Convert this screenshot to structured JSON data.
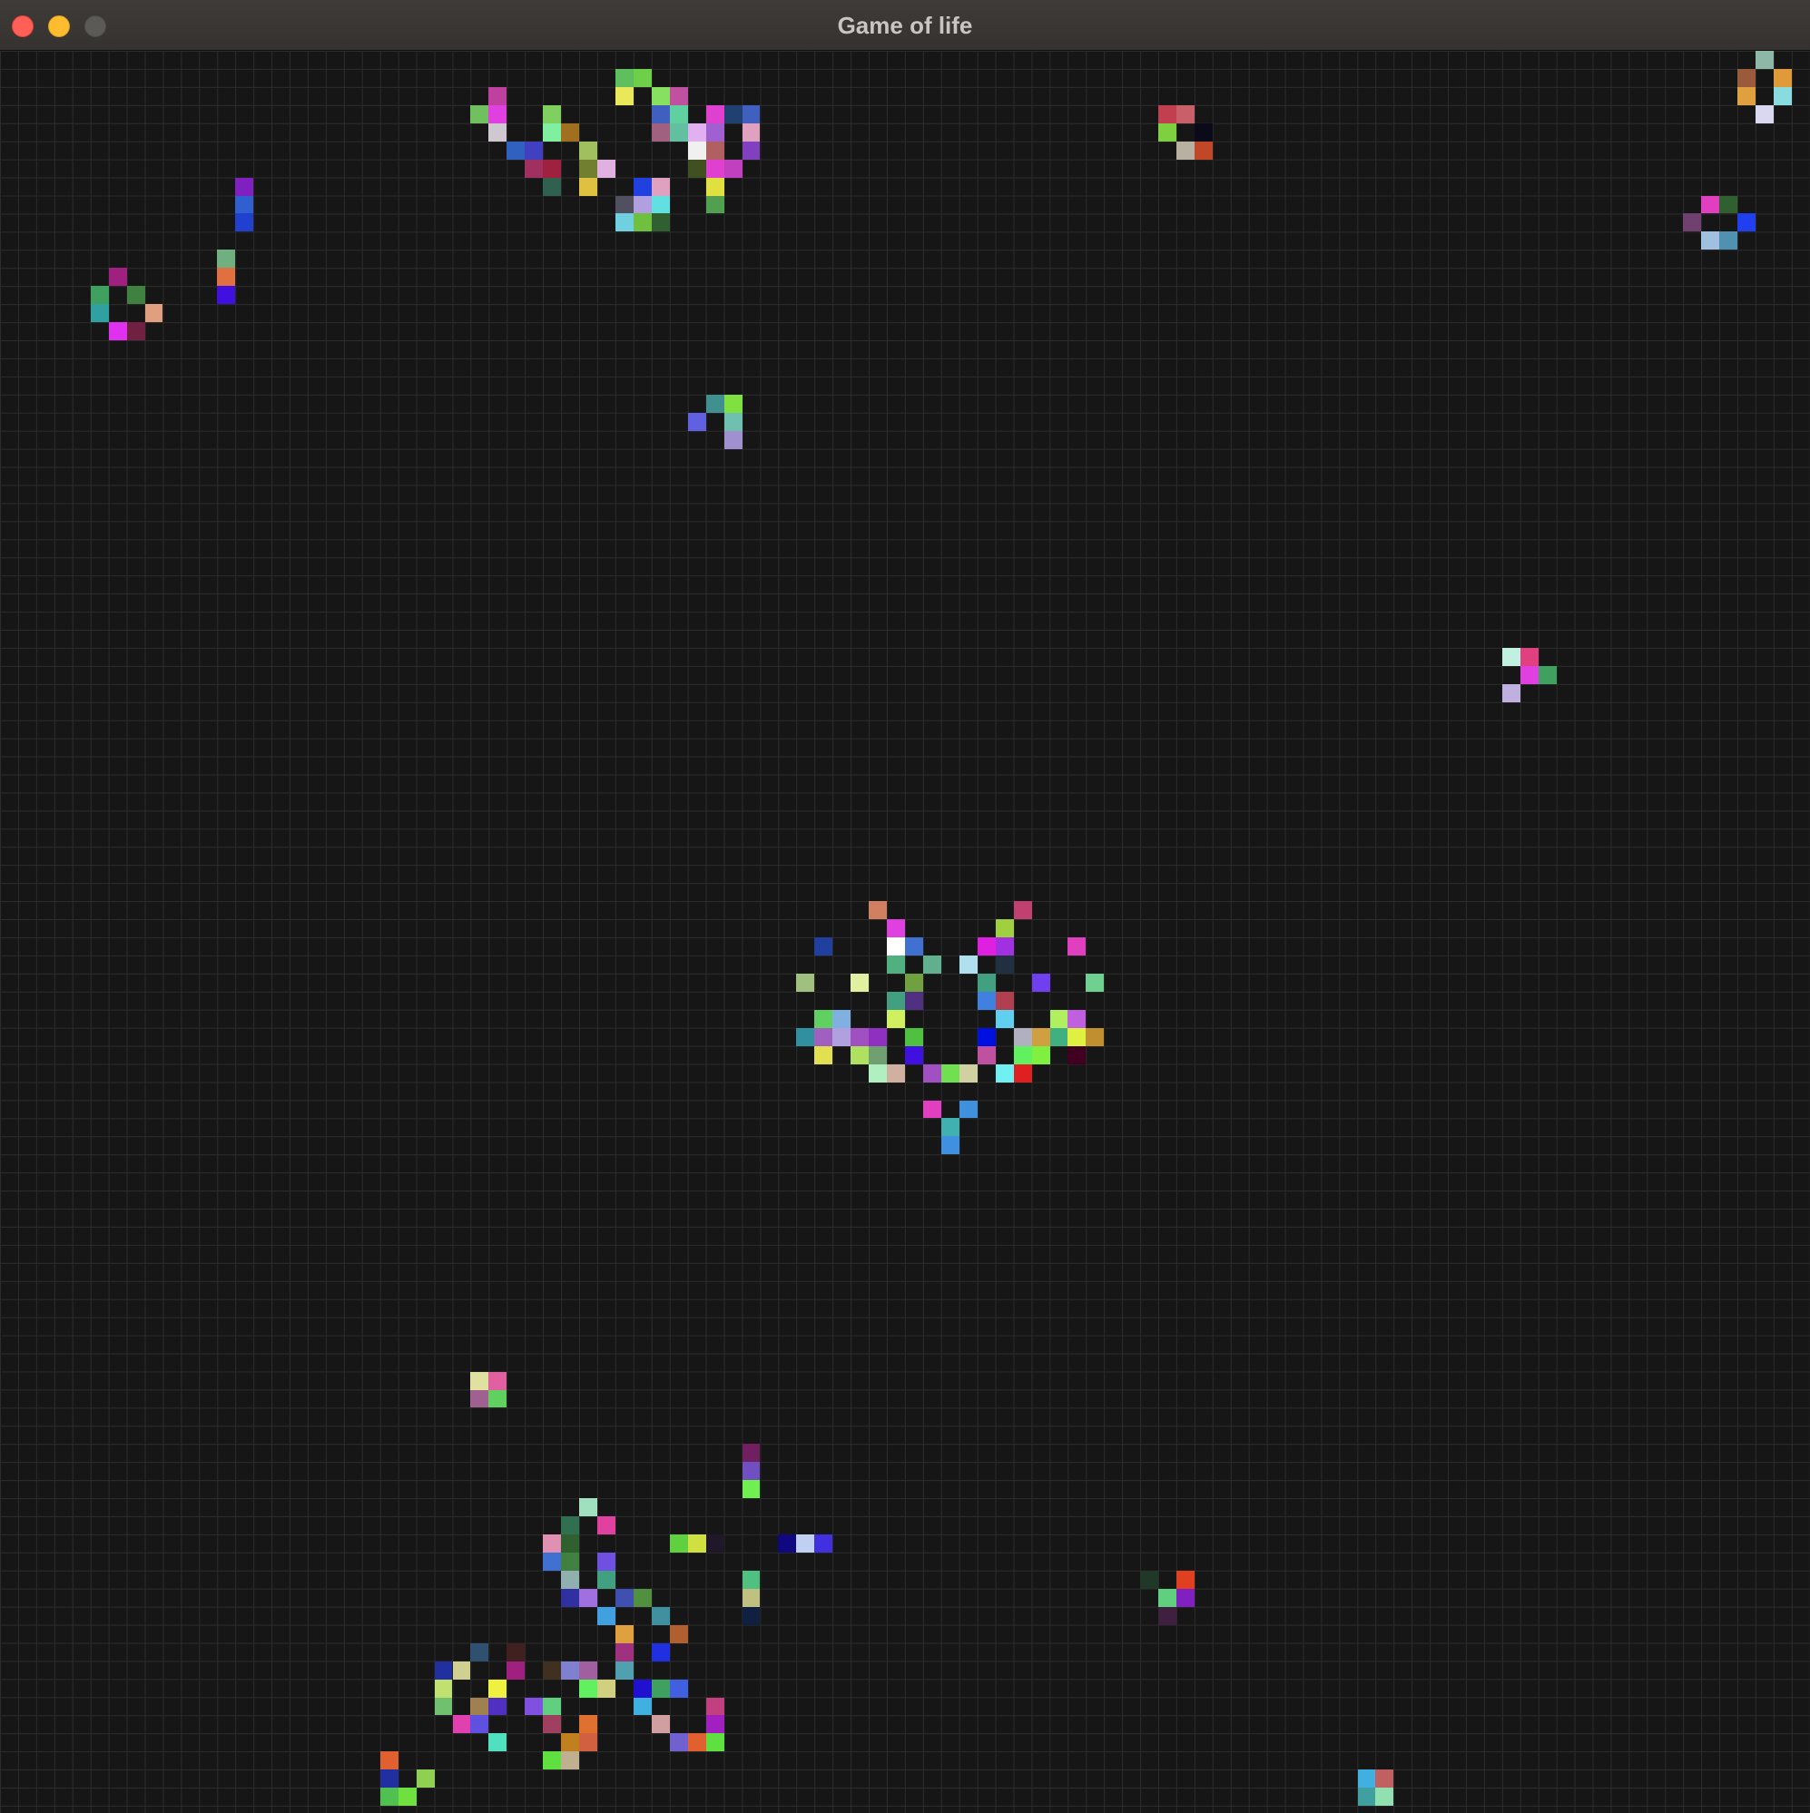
{
  "window": {
    "title": "Game of life"
  },
  "traffic_lights": {
    "close_color": "#ff5f57",
    "minimize_color": "#febc2e",
    "maximize_color": "#5c5a57"
  },
  "board": {
    "columns": 100,
    "rows": 97,
    "background_color": "#161616",
    "grid_line_color": "#2c2c2c",
    "live_cells": [
      [
        97,
        0,
        "#8fb7a8"
      ],
      [
        96,
        1,
        "#9a5a3c"
      ],
      [
        98,
        1,
        "#e09a3a"
      ],
      [
        96,
        2,
        "#e0a040"
      ],
      [
        98,
        2,
        "#8adbe0"
      ],
      [
        97,
        3,
        "#d8d8f0"
      ],
      [
        64,
        3,
        "#c04050"
      ],
      [
        65,
        3,
        "#c8606a"
      ],
      [
        64,
        4,
        "#7ed040"
      ],
      [
        66,
        4,
        "#0a0a18"
      ],
      [
        65,
        5,
        "#b8b0a0"
      ],
      [
        66,
        5,
        "#c04828"
      ],
      [
        34,
        1,
        "#5fbf5f"
      ],
      [
        35,
        1,
        "#6ed04a"
      ],
      [
        34,
        2,
        "#e8e85a"
      ],
      [
        36,
        2,
        "#88e060"
      ],
      [
        37,
        2,
        "#c050a0"
      ],
      [
        27,
        2,
        "#c040a0"
      ],
      [
        26,
        3,
        "#70c060"
      ],
      [
        27,
        3,
        "#e040e0"
      ],
      [
        30,
        3,
        "#80d060"
      ],
      [
        36,
        3,
        "#4060c0"
      ],
      [
        37,
        3,
        "#60d0a0"
      ],
      [
        39,
        3,
        "#e040d0"
      ],
      [
        40,
        3,
        "#204070"
      ],
      [
        41,
        3,
        "#4060c0"
      ],
      [
        27,
        4,
        "#d0c8d0"
      ],
      [
        30,
        4,
        "#80f0a0"
      ],
      [
        31,
        4,
        "#a07020"
      ],
      [
        36,
        4,
        "#a06080"
      ],
      [
        37,
        4,
        "#60c0a0"
      ],
      [
        38,
        4,
        "#e0b0f0"
      ],
      [
        39,
        4,
        "#a060d0"
      ],
      [
        41,
        4,
        "#e0a0c0"
      ],
      [
        28,
        5,
        "#3060c0"
      ],
      [
        29,
        5,
        "#4040c0"
      ],
      [
        32,
        5,
        "#a0c060"
      ],
      [
        38,
        5,
        "#f0f0f0"
      ],
      [
        39,
        5,
        "#b06060"
      ],
      [
        41,
        5,
        "#8040c0"
      ],
      [
        29,
        6,
        "#a03060"
      ],
      [
        30,
        6,
        "#a02040"
      ],
      [
        32,
        6,
        "#708030"
      ],
      [
        33,
        6,
        "#e0b0e0"
      ],
      [
        38,
        6,
        "#405020"
      ],
      [
        39,
        6,
        "#e040d0"
      ],
      [
        40,
        6,
        "#c040c0"
      ],
      [
        30,
        7,
        "#306050"
      ],
      [
        32,
        7,
        "#e0c040"
      ],
      [
        35,
        7,
        "#2040e0"
      ],
      [
        36,
        7,
        "#e0a0c0"
      ],
      [
        39,
        7,
        "#e0e040"
      ],
      [
        34,
        8,
        "#505060"
      ],
      [
        35,
        8,
        "#b0a0e0"
      ],
      [
        36,
        8,
        "#60e0e0"
      ],
      [
        39,
        8,
        "#50a050"
      ],
      [
        34,
        9,
        "#70d0e0"
      ],
      [
        35,
        9,
        "#70c040"
      ],
      [
        36,
        9,
        "#306030"
      ],
      [
        13,
        7,
        "#8020c0"
      ],
      [
        13,
        8,
        "#3060d0"
      ],
      [
        13,
        9,
        "#2040d0"
      ],
      [
        12,
        11,
        "#70b080"
      ],
      [
        12,
        12,
        "#e07040"
      ],
      [
        12,
        13,
        "#4010e0"
      ],
      [
        6,
        12,
        "#a02080"
      ],
      [
        5,
        13,
        "#40a060"
      ],
      [
        7,
        13,
        "#408040"
      ],
      [
        5,
        14,
        "#30a0a0"
      ],
      [
        8,
        14,
        "#e0a080"
      ],
      [
        6,
        15,
        "#e030f0"
      ],
      [
        7,
        15,
        "#702040"
      ],
      [
        94,
        8,
        "#e040c0"
      ],
      [
        95,
        8,
        "#306030"
      ],
      [
        93,
        9,
        "#704070"
      ],
      [
        96,
        9,
        "#2040f0"
      ],
      [
        94,
        10,
        "#a0c0e0"
      ],
      [
        95,
        10,
        "#5090b0"
      ],
      [
        39,
        19,
        "#409090"
      ],
      [
        40,
        19,
        "#80e040"
      ],
      [
        38,
        20,
        "#6060e0"
      ],
      [
        40,
        20,
        "#70c0b0"
      ],
      [
        40,
        21,
        "#a090d0"
      ],
      [
        83,
        33,
        "#c0f0e0"
      ],
      [
        84,
        33,
        "#e04080"
      ],
      [
        84,
        34,
        "#e040e0"
      ],
      [
        85,
        34,
        "#40a060"
      ],
      [
        83,
        35,
        "#c0b0e0"
      ],
      [
        48,
        47,
        "#d08060"
      ],
      [
        56,
        47,
        "#c04070"
      ],
      [
        49,
        48,
        "#e040e0"
      ],
      [
        55,
        48,
        "#a0d040"
      ],
      [
        45,
        49,
        "#2040a0"
      ],
      [
        49,
        49,
        "#ffffff"
      ],
      [
        50,
        49,
        "#4070d0"
      ],
      [
        54,
        49,
        "#e020e0"
      ],
      [
        55,
        49,
        "#a030e0"
      ],
      [
        59,
        49,
        "#e040c0"
      ],
      [
        49,
        50,
        "#50b080"
      ],
      [
        51,
        50,
        "#60b090"
      ],
      [
        53,
        50,
        "#b0e0f0"
      ],
      [
        55,
        50,
        "#203040"
      ],
      [
        44,
        51,
        "#a0c080"
      ],
      [
        47,
        51,
        "#e0f0a0"
      ],
      [
        50,
        51,
        "#70a040"
      ],
      [
        54,
        51,
        "#40a080"
      ],
      [
        57,
        51,
        "#7040f0"
      ],
      [
        60,
        51,
        "#70d090"
      ],
      [
        49,
        52,
        "#40a080"
      ],
      [
        50,
        52,
        "#503080"
      ],
      [
        54,
        52,
        "#4080e0"
      ],
      [
        55,
        52,
        "#b04050"
      ],
      [
        45,
        53,
        "#60d060"
      ],
      [
        46,
        53,
        "#80b0e0"
      ],
      [
        49,
        53,
        "#d0f060"
      ],
      [
        55,
        53,
        "#60d0f0"
      ],
      [
        58,
        53,
        "#b0f060"
      ],
      [
        59,
        53,
        "#c060e0"
      ],
      [
        44,
        54,
        "#3090a0"
      ],
      [
        45,
        54,
        "#a060c0"
      ],
      [
        46,
        54,
        "#b0a0e0"
      ],
      [
        47,
        54,
        "#a050c0"
      ],
      [
        48,
        54,
        "#9030c0"
      ],
      [
        50,
        54,
        "#50c040"
      ],
      [
        54,
        54,
        "#0010e0"
      ],
      [
        56,
        54,
        "#b0b0c0"
      ],
      [
        57,
        54,
        "#d0a040"
      ],
      [
        58,
        54,
        "#40b080"
      ],
      [
        59,
        54,
        "#e0f040"
      ],
      [
        60,
        54,
        "#c09030"
      ],
      [
        45,
        55,
        "#e0e050"
      ],
      [
        47,
        55,
        "#b0e060"
      ],
      [
        48,
        55,
        "#70a070"
      ],
      [
        50,
        55,
        "#4010e0"
      ],
      [
        54,
        55,
        "#c050a0"
      ],
      [
        56,
        55,
        "#60f060"
      ],
      [
        57,
        55,
        "#80f040"
      ],
      [
        59,
        55,
        "#400020"
      ],
      [
        48,
        56,
        "#b0f0c0"
      ],
      [
        49,
        56,
        "#d0b0a0"
      ],
      [
        51,
        56,
        "#a050c0"
      ],
      [
        52,
        56,
        "#70e050"
      ],
      [
        53,
        56,
        "#d0d0a0"
      ],
      [
        55,
        56,
        "#70f0f0"
      ],
      [
        56,
        56,
        "#e02020"
      ],
      [
        51,
        58,
        "#e040c0"
      ],
      [
        53,
        58,
        "#4090e0"
      ],
      [
        52,
        59,
        "#40b0b0"
      ],
      [
        52,
        60,
        "#4090e0"
      ],
      [
        26,
        73,
        "#e0e0a0"
      ],
      [
        27,
        73,
        "#e060a0"
      ],
      [
        26,
        74,
        "#a06090"
      ],
      [
        27,
        74,
        "#60d060"
      ],
      [
        41,
        77,
        "#702060"
      ],
      [
        41,
        78,
        "#7050c0"
      ],
      [
        41,
        79,
        "#70f050"
      ],
      [
        32,
        80,
        "#a0e0c0"
      ],
      [
        31,
        81,
        "#307050"
      ],
      [
        33,
        81,
        "#e040a0"
      ],
      [
        30,
        82,
        "#e090b0"
      ],
      [
        31,
        82,
        "#306030"
      ],
      [
        37,
        82,
        "#60d040"
      ],
      [
        38,
        82,
        "#d0e040"
      ],
      [
        39,
        82,
        "#201828"
      ],
      [
        43,
        82,
        "#100880"
      ],
      [
        44,
        82,
        "#c0d0f0"
      ],
      [
        45,
        82,
        "#4030e0"
      ],
      [
        30,
        83,
        "#4070d0"
      ],
      [
        31,
        83,
        "#408040"
      ],
      [
        33,
        83,
        "#7050e0"
      ],
      [
        31,
        84,
        "#90b0b0"
      ],
      [
        33,
        84,
        "#40a080"
      ],
      [
        41,
        84,
        "#50c080"
      ],
      [
        31,
        85,
        "#3030a0"
      ],
      [
        32,
        85,
        "#a070e0"
      ],
      [
        34,
        85,
        "#4050b0"
      ],
      [
        35,
        85,
        "#509040"
      ],
      [
        41,
        85,
        "#c0c080"
      ],
      [
        33,
        86,
        "#40a0e0"
      ],
      [
        36,
        86,
        "#4090a0"
      ],
      [
        41,
        86,
        "#102040"
      ],
      [
        34,
        87,
        "#e0a040"
      ],
      [
        37,
        87,
        "#b06030"
      ],
      [
        26,
        88,
        "#305070"
      ],
      [
        28,
        88,
        "#402020"
      ],
      [
        34,
        88,
        "#a03080"
      ],
      [
        36,
        88,
        "#2030e0"
      ],
      [
        24,
        89,
        "#2030a0"
      ],
      [
        25,
        89,
        "#d0d090"
      ],
      [
        28,
        89,
        "#a02080"
      ],
      [
        30,
        89,
        "#403020"
      ],
      [
        31,
        89,
        "#8080d0"
      ],
      [
        32,
        89,
        "#a060a0"
      ],
      [
        34,
        89,
        "#50a0b0"
      ],
      [
        24,
        90,
        "#c0e070"
      ],
      [
        27,
        90,
        "#f0f040"
      ],
      [
        32,
        90,
        "#60f060"
      ],
      [
        33,
        90,
        "#d0d080"
      ],
      [
        35,
        90,
        "#2010d0"
      ],
      [
        36,
        90,
        "#40a060"
      ],
      [
        37,
        90,
        "#4060e0"
      ],
      [
        24,
        91,
        "#70c070"
      ],
      [
        26,
        91,
        "#a08050"
      ],
      [
        27,
        91,
        "#5030c0"
      ],
      [
        29,
        91,
        "#8050e0"
      ],
      [
        30,
        91,
        "#60d080"
      ],
      [
        35,
        91,
        "#40b0e0"
      ],
      [
        39,
        91,
        "#c04080"
      ],
      [
        25,
        92,
        "#e040b0"
      ],
      [
        26,
        92,
        "#6050e0"
      ],
      [
        30,
        92,
        "#a04060"
      ],
      [
        32,
        92,
        "#e07030"
      ],
      [
        36,
        92,
        "#d0a0a0"
      ],
      [
        39,
        92,
        "#a020c0"
      ],
      [
        27,
        93,
        "#50e0c0"
      ],
      [
        31,
        93,
        "#c08020"
      ],
      [
        32,
        93,
        "#d06040"
      ],
      [
        37,
        93,
        "#7060d0"
      ],
      [
        38,
        93,
        "#e06030"
      ],
      [
        39,
        93,
        "#60e040"
      ],
      [
        21,
        94,
        "#e06030"
      ],
      [
        30,
        94,
        "#60e040"
      ],
      [
        31,
        94,
        "#c0b090"
      ],
      [
        21,
        95,
        "#2030a0"
      ],
      [
        23,
        95,
        "#90d050"
      ],
      [
        21,
        96,
        "#50c050"
      ],
      [
        22,
        96,
        "#70e040"
      ],
      [
        63,
        84,
        "#203828"
      ],
      [
        65,
        84,
        "#e04020"
      ],
      [
        64,
        85,
        "#60d080"
      ],
      [
        65,
        85,
        "#8020c0"
      ],
      [
        64,
        86,
        "#402040"
      ],
      [
        75,
        95,
        "#40b0e0"
      ],
      [
        76,
        95,
        "#c06060"
      ],
      [
        75,
        96,
        "#40a0a0"
      ],
      [
        76,
        96,
        "#90e0b0"
      ]
    ]
  }
}
